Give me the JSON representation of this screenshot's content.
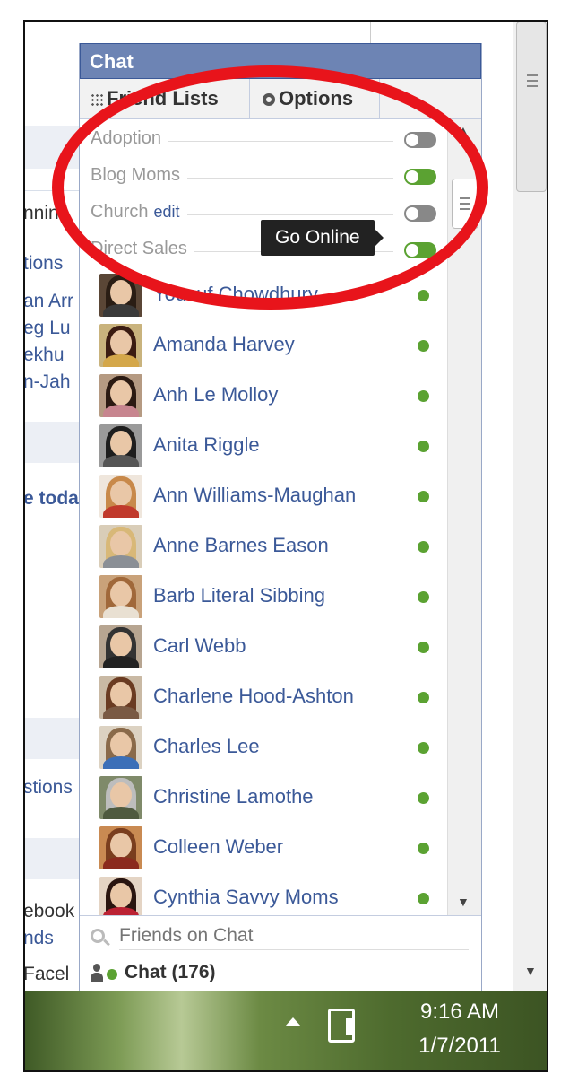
{
  "chat": {
    "title": "Chat",
    "tabs": [
      {
        "label": "Friend Lists",
        "icon": "grid-icon"
      },
      {
        "label": "Options",
        "icon": "gear-icon"
      }
    ],
    "friend_lists": [
      {
        "name": "Adoption",
        "status": "offline"
      },
      {
        "name": "Blog Moms",
        "status": "online"
      },
      {
        "name": "Church",
        "edit_label": "edit",
        "status": "offline"
      },
      {
        "name": "Direct Sales",
        "status": "online"
      }
    ],
    "tooltip": "Go Online",
    "friends": [
      {
        "name": "Yousuf Chowdhury",
        "online": true
      },
      {
        "name": "Amanda Harvey",
        "online": true
      },
      {
        "name": "Anh Le Molloy",
        "online": true
      },
      {
        "name": "Anita Riggle",
        "online": true
      },
      {
        "name": "Ann Williams-Maughan",
        "online": true
      },
      {
        "name": "Anne Barnes Eason",
        "online": true
      },
      {
        "name": "Barb Literal Sibbing",
        "online": true
      },
      {
        "name": "Carl Webb",
        "online": true
      },
      {
        "name": "Charlene Hood-Ashton",
        "online": true
      },
      {
        "name": "Charles Lee",
        "online": true
      },
      {
        "name": "Christine Lamothe",
        "online": true
      },
      {
        "name": "Colleen Weber",
        "online": true
      },
      {
        "name": "Cynthia Savvy Moms",
        "online": true
      }
    ],
    "search_placeholder": "Friends on Chat",
    "chat_bar_label": "Chat (176)"
  },
  "background": {
    "fragments": [
      "nnin",
      "tions",
      "an Arr",
      "eg Lu",
      "ekhu",
      "n-Jah",
      "e toda",
      "stions",
      "ebook",
      "nds",
      "Facel"
    ]
  },
  "taskbar": {
    "time": "9:16 AM",
    "date": "1/7/2011"
  },
  "colors": {
    "facebook_blue": "#3b5998",
    "header_blue": "#6d84b4",
    "online_green": "#5ba232",
    "annotation_red": "#e8141b"
  }
}
